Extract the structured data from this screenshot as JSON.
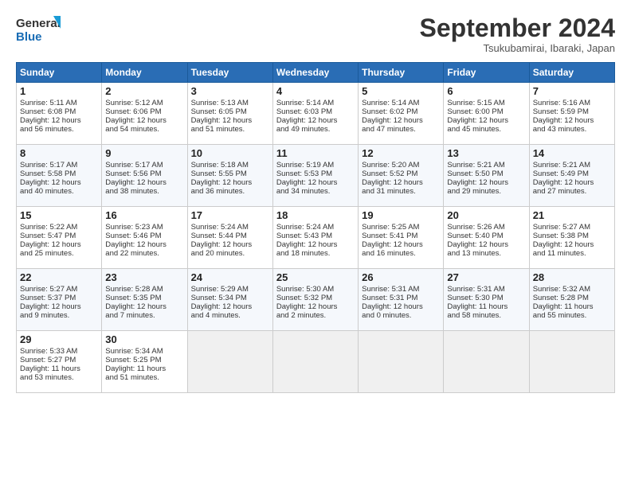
{
  "header": {
    "logo_line1": "General",
    "logo_line2": "Blue",
    "month_title": "September 2024",
    "location": "Tsukubamirai, Ibaraki, Japan"
  },
  "weekdays": [
    "Sunday",
    "Monday",
    "Tuesday",
    "Wednesday",
    "Thursday",
    "Friday",
    "Saturday"
  ],
  "weeks": [
    [
      {
        "day": "1",
        "lines": [
          "Sunrise: 5:11 AM",
          "Sunset: 6:08 PM",
          "Daylight: 12 hours",
          "and 56 minutes."
        ]
      },
      {
        "day": "2",
        "lines": [
          "Sunrise: 5:12 AM",
          "Sunset: 6:06 PM",
          "Daylight: 12 hours",
          "and 54 minutes."
        ]
      },
      {
        "day": "3",
        "lines": [
          "Sunrise: 5:13 AM",
          "Sunset: 6:05 PM",
          "Daylight: 12 hours",
          "and 51 minutes."
        ]
      },
      {
        "day": "4",
        "lines": [
          "Sunrise: 5:14 AM",
          "Sunset: 6:03 PM",
          "Daylight: 12 hours",
          "and 49 minutes."
        ]
      },
      {
        "day": "5",
        "lines": [
          "Sunrise: 5:14 AM",
          "Sunset: 6:02 PM",
          "Daylight: 12 hours",
          "and 47 minutes."
        ]
      },
      {
        "day": "6",
        "lines": [
          "Sunrise: 5:15 AM",
          "Sunset: 6:00 PM",
          "Daylight: 12 hours",
          "and 45 minutes."
        ]
      },
      {
        "day": "7",
        "lines": [
          "Sunrise: 5:16 AM",
          "Sunset: 5:59 PM",
          "Daylight: 12 hours",
          "and 43 minutes."
        ]
      }
    ],
    [
      {
        "day": "8",
        "lines": [
          "Sunrise: 5:17 AM",
          "Sunset: 5:58 PM",
          "Daylight: 12 hours",
          "and 40 minutes."
        ]
      },
      {
        "day": "9",
        "lines": [
          "Sunrise: 5:17 AM",
          "Sunset: 5:56 PM",
          "Daylight: 12 hours",
          "and 38 minutes."
        ]
      },
      {
        "day": "10",
        "lines": [
          "Sunrise: 5:18 AM",
          "Sunset: 5:55 PM",
          "Daylight: 12 hours",
          "and 36 minutes."
        ]
      },
      {
        "day": "11",
        "lines": [
          "Sunrise: 5:19 AM",
          "Sunset: 5:53 PM",
          "Daylight: 12 hours",
          "and 34 minutes."
        ]
      },
      {
        "day": "12",
        "lines": [
          "Sunrise: 5:20 AM",
          "Sunset: 5:52 PM",
          "Daylight: 12 hours",
          "and 31 minutes."
        ]
      },
      {
        "day": "13",
        "lines": [
          "Sunrise: 5:21 AM",
          "Sunset: 5:50 PM",
          "Daylight: 12 hours",
          "and 29 minutes."
        ]
      },
      {
        "day": "14",
        "lines": [
          "Sunrise: 5:21 AM",
          "Sunset: 5:49 PM",
          "Daylight: 12 hours",
          "and 27 minutes."
        ]
      }
    ],
    [
      {
        "day": "15",
        "lines": [
          "Sunrise: 5:22 AM",
          "Sunset: 5:47 PM",
          "Daylight: 12 hours",
          "and 25 minutes."
        ]
      },
      {
        "day": "16",
        "lines": [
          "Sunrise: 5:23 AM",
          "Sunset: 5:46 PM",
          "Daylight: 12 hours",
          "and 22 minutes."
        ]
      },
      {
        "day": "17",
        "lines": [
          "Sunrise: 5:24 AM",
          "Sunset: 5:44 PM",
          "Daylight: 12 hours",
          "and 20 minutes."
        ]
      },
      {
        "day": "18",
        "lines": [
          "Sunrise: 5:24 AM",
          "Sunset: 5:43 PM",
          "Daylight: 12 hours",
          "and 18 minutes."
        ]
      },
      {
        "day": "19",
        "lines": [
          "Sunrise: 5:25 AM",
          "Sunset: 5:41 PM",
          "Daylight: 12 hours",
          "and 16 minutes."
        ]
      },
      {
        "day": "20",
        "lines": [
          "Sunrise: 5:26 AM",
          "Sunset: 5:40 PM",
          "Daylight: 12 hours",
          "and 13 minutes."
        ]
      },
      {
        "day": "21",
        "lines": [
          "Sunrise: 5:27 AM",
          "Sunset: 5:38 PM",
          "Daylight: 12 hours",
          "and 11 minutes."
        ]
      }
    ],
    [
      {
        "day": "22",
        "lines": [
          "Sunrise: 5:27 AM",
          "Sunset: 5:37 PM",
          "Daylight: 12 hours",
          "and 9 minutes."
        ]
      },
      {
        "day": "23",
        "lines": [
          "Sunrise: 5:28 AM",
          "Sunset: 5:35 PM",
          "Daylight: 12 hours",
          "and 7 minutes."
        ]
      },
      {
        "day": "24",
        "lines": [
          "Sunrise: 5:29 AM",
          "Sunset: 5:34 PM",
          "Daylight: 12 hours",
          "and 4 minutes."
        ]
      },
      {
        "day": "25",
        "lines": [
          "Sunrise: 5:30 AM",
          "Sunset: 5:32 PM",
          "Daylight: 12 hours",
          "and 2 minutes."
        ]
      },
      {
        "day": "26",
        "lines": [
          "Sunrise: 5:31 AM",
          "Sunset: 5:31 PM",
          "Daylight: 12 hours",
          "and 0 minutes."
        ]
      },
      {
        "day": "27",
        "lines": [
          "Sunrise: 5:31 AM",
          "Sunset: 5:30 PM",
          "Daylight: 11 hours",
          "and 58 minutes."
        ]
      },
      {
        "day": "28",
        "lines": [
          "Sunrise: 5:32 AM",
          "Sunset: 5:28 PM",
          "Daylight: 11 hours",
          "and 55 minutes."
        ]
      }
    ],
    [
      {
        "day": "29",
        "lines": [
          "Sunrise: 5:33 AM",
          "Sunset: 5:27 PM",
          "Daylight: 11 hours",
          "and 53 minutes."
        ]
      },
      {
        "day": "30",
        "lines": [
          "Sunrise: 5:34 AM",
          "Sunset: 5:25 PM",
          "Daylight: 11 hours",
          "and 51 minutes."
        ]
      },
      {
        "day": "",
        "lines": []
      },
      {
        "day": "",
        "lines": []
      },
      {
        "day": "",
        "lines": []
      },
      {
        "day": "",
        "lines": []
      },
      {
        "day": "",
        "lines": []
      }
    ]
  ]
}
